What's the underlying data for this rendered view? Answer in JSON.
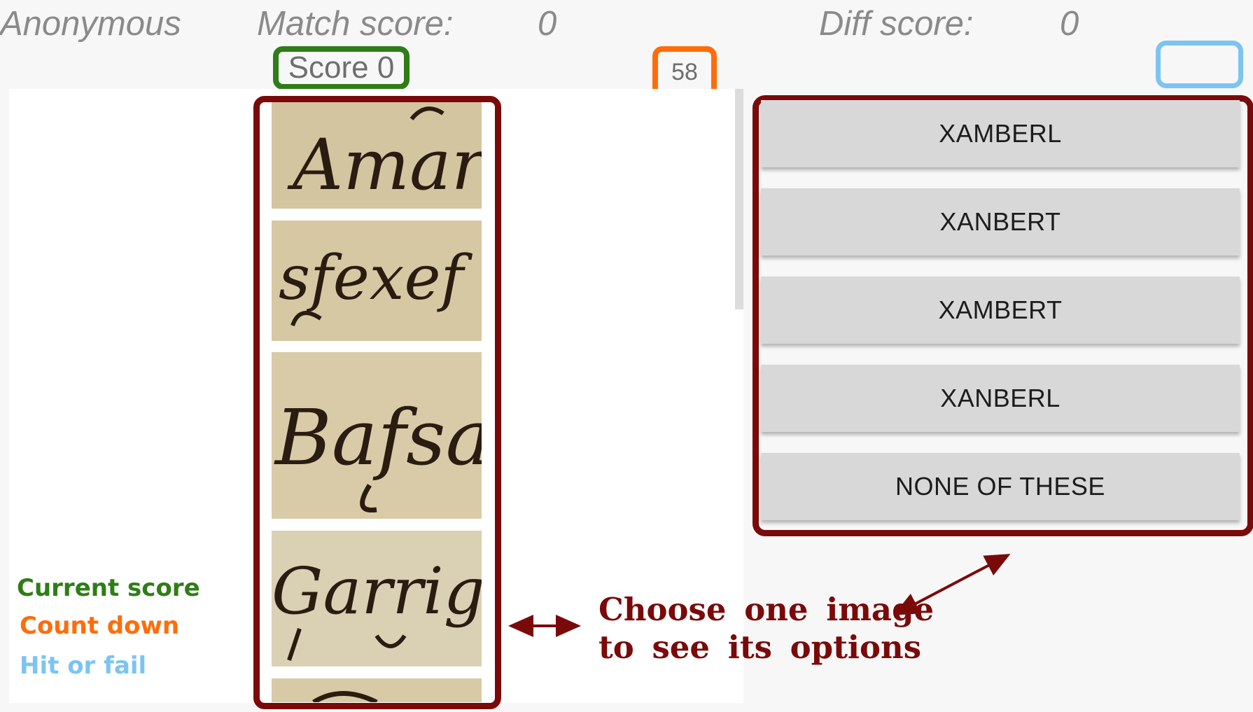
{
  "header": {
    "user": "Anonymous",
    "match_label": "Match score:",
    "match_value": "0",
    "diff_label": "Diff score:",
    "diff_value": "0"
  },
  "status": {
    "score": "Score 0",
    "countdown": "58",
    "hit_or_fail": ""
  },
  "images": [
    {
      "word": "Amar"
    },
    {
      "word": "sfexef"
    },
    {
      "word": "Bafsa"
    },
    {
      "word": "Garriga"
    },
    {
      "word": ""
    }
  ],
  "options": [
    "XAMBERL",
    "XANBERT",
    "XAMBERT",
    "XANBERL",
    "NONE OF THESE"
  ],
  "legend": {
    "current_score": "Current score",
    "count_down": "Count down",
    "hit_or_fail": "Hit or fail"
  },
  "annotation": {
    "line1": "Choose one image",
    "line2": "to see its options"
  },
  "colors": {
    "score": "#2e7d16",
    "countdown": "#ff6d0a",
    "hit_or_fail": "#7cc4f2",
    "frame": "#7a0a0a"
  }
}
